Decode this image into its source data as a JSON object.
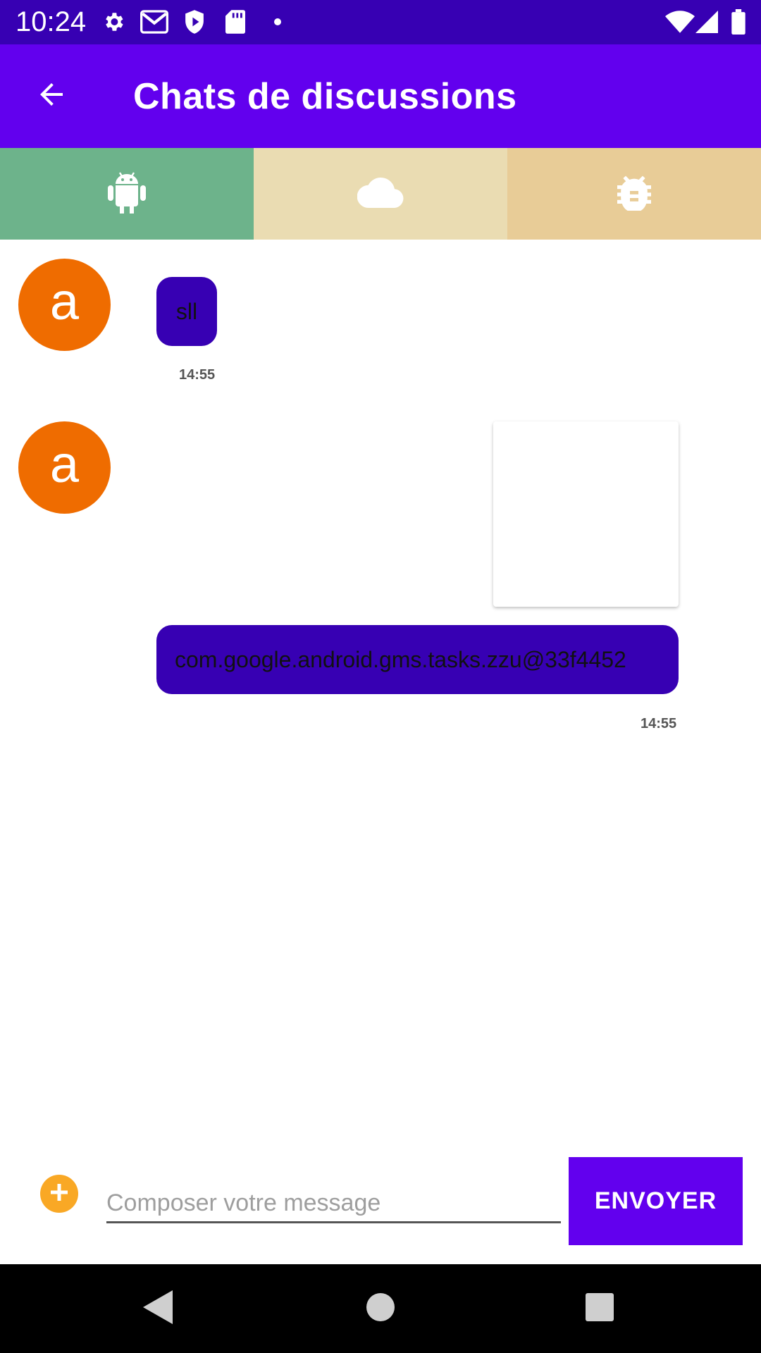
{
  "status_bar": {
    "time": "10:24",
    "icons": [
      "settings-icon",
      "gmail-icon",
      "shield-icon",
      "sd-card-icon",
      "dot-icon",
      "wifi-icon",
      "signal-icon",
      "battery-icon"
    ]
  },
  "app_bar": {
    "title": "Chats de discussions",
    "back_icon": "arrow-back-icon"
  },
  "tabs": [
    {
      "icon": "android-icon",
      "color": "#6db38b"
    },
    {
      "icon": "cloud-icon",
      "color": "#eadcb2"
    },
    {
      "icon": "bug-icon",
      "color": "#e8cc97"
    }
  ],
  "messages": [
    {
      "avatar": "a",
      "text": "sll",
      "time": "14:55"
    },
    {
      "avatar": "a",
      "text": "com.google.android.gms.tasks.zzu@33f4452",
      "time": "14:55",
      "has_image": true
    }
  ],
  "composer": {
    "placeholder": "Composer votre message",
    "value": "",
    "send_label": "ENVOYER",
    "add_icon": "add-circle-icon"
  },
  "colors": {
    "status_bar": "#3700b3",
    "app_bar": "#6200ee",
    "bubble": "#3700b3",
    "avatar": "#ef6c00",
    "add_button": "#f9a825"
  },
  "nav_bar": {
    "icons": [
      "back-triangle-icon",
      "home-circle-icon",
      "recents-square-icon"
    ]
  }
}
